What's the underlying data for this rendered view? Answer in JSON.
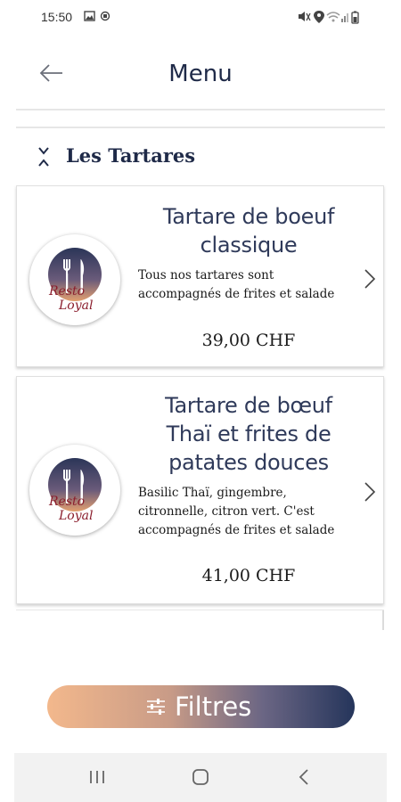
{
  "status_bar": {
    "time": "15:50",
    "left_icons": [
      "image-icon",
      "sync-icon"
    ],
    "right_icons": [
      "mute-icon",
      "location-icon",
      "wifi-icon",
      "signal-icon",
      "battery-icon"
    ]
  },
  "header": {
    "title": "Menu",
    "back_icon": "arrow-left-icon"
  },
  "section": {
    "title": "Les Tartares",
    "icon": "collapse-icon"
  },
  "items": [
    {
      "name": "Tartare de boeuf classique",
      "description": "Tous nos tartares sont accompagnés de frites et salade",
      "price": "39,00 CHF",
      "logo_text": [
        "Resto",
        "Loyal"
      ]
    },
    {
      "name": "Tartare de bœuf Thaï et frites de patates douces",
      "description": "Basilic Thaï, gingembre, citronnelle, citron vert. C'est accompagnés de frites et salade",
      "price": "41,00 CHF",
      "logo_text": [
        "Resto",
        "Loyal"
      ]
    }
  ],
  "filter_button": {
    "label": "Filtres",
    "icon": "sliders-icon"
  },
  "nav_bar": {
    "icons": [
      "recents-icon",
      "home-icon",
      "back-icon"
    ]
  },
  "colors": {
    "primary": "#1f2a48",
    "gradient_start": "#f3b88c",
    "gradient_end": "#25355b",
    "logo_red": "#8b1e2d"
  }
}
